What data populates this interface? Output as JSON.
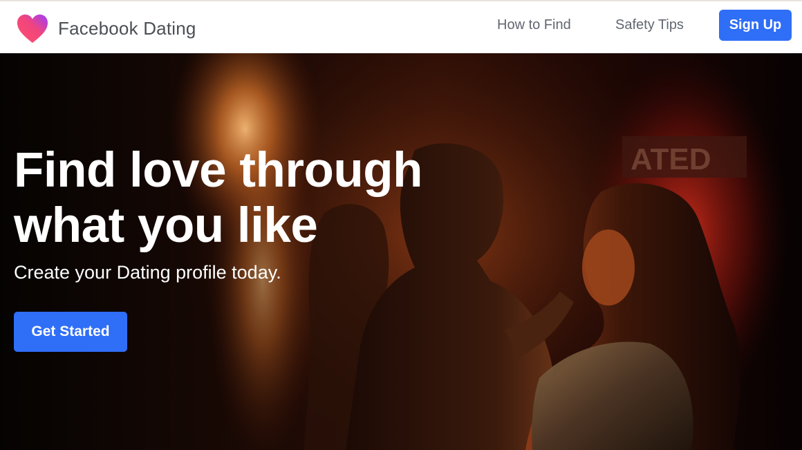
{
  "header": {
    "brand": "Facebook Dating",
    "logo_icon": "heart-logo-icon",
    "nav": [
      {
        "label": "How to Find"
      },
      {
        "label": "Safety Tips"
      }
    ],
    "signup_label": "Sign Up"
  },
  "hero": {
    "title_line1": "Find love through",
    "title_line2": "what you like",
    "subtitle": "Create your Dating profile today.",
    "cta_label": "Get Started",
    "sign_text": "ATED"
  },
  "colors": {
    "accent": "#2f6ef6",
    "heart_start": "#ff5a73",
    "heart_end": "#a033ff"
  }
}
